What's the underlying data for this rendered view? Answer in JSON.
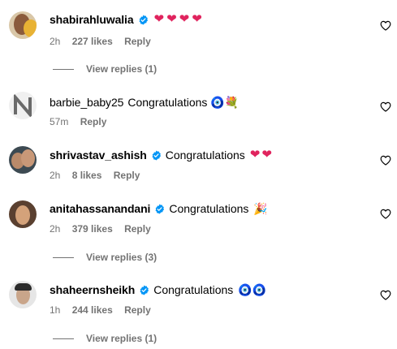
{
  "comments": [
    {
      "username": "shabirahluwalia",
      "verified": true,
      "text": "",
      "emoji": "❤❤❤❤",
      "time": "2h",
      "likes": "227 likes",
      "reply": "Reply",
      "view_replies": "View replies (1)"
    },
    {
      "username": "barbie_baby25",
      "verified": false,
      "text": "Congratulations",
      "emoji": "🧿💐",
      "time": "57m",
      "likes": "",
      "reply": "Reply",
      "view_replies": ""
    },
    {
      "username": "shrivastav_ashish",
      "verified": true,
      "text": "Congratulations",
      "emoji": "❤❤",
      "time": "2h",
      "likes": "8 likes",
      "reply": "Reply",
      "view_replies": ""
    },
    {
      "username": "anitahassanandani",
      "verified": true,
      "text": "Congratulations",
      "emoji": "🎉",
      "time": "2h",
      "likes": "379 likes",
      "reply": "Reply",
      "view_replies": "View replies (3)"
    },
    {
      "username": "shaheernsheikh",
      "verified": true,
      "text": "Congratulations",
      "emoji": "🧿🧿",
      "time": "1h",
      "likes": "244 likes",
      "reply": "Reply",
      "view_replies": "View replies (1)"
    }
  ],
  "colors": {
    "verified_badge": "#0095f6",
    "muted_text": "#737373",
    "heart_red": "#e0245e"
  },
  "icons": {
    "like": "heart-outline-icon",
    "verified": "verified-badge-icon"
  }
}
